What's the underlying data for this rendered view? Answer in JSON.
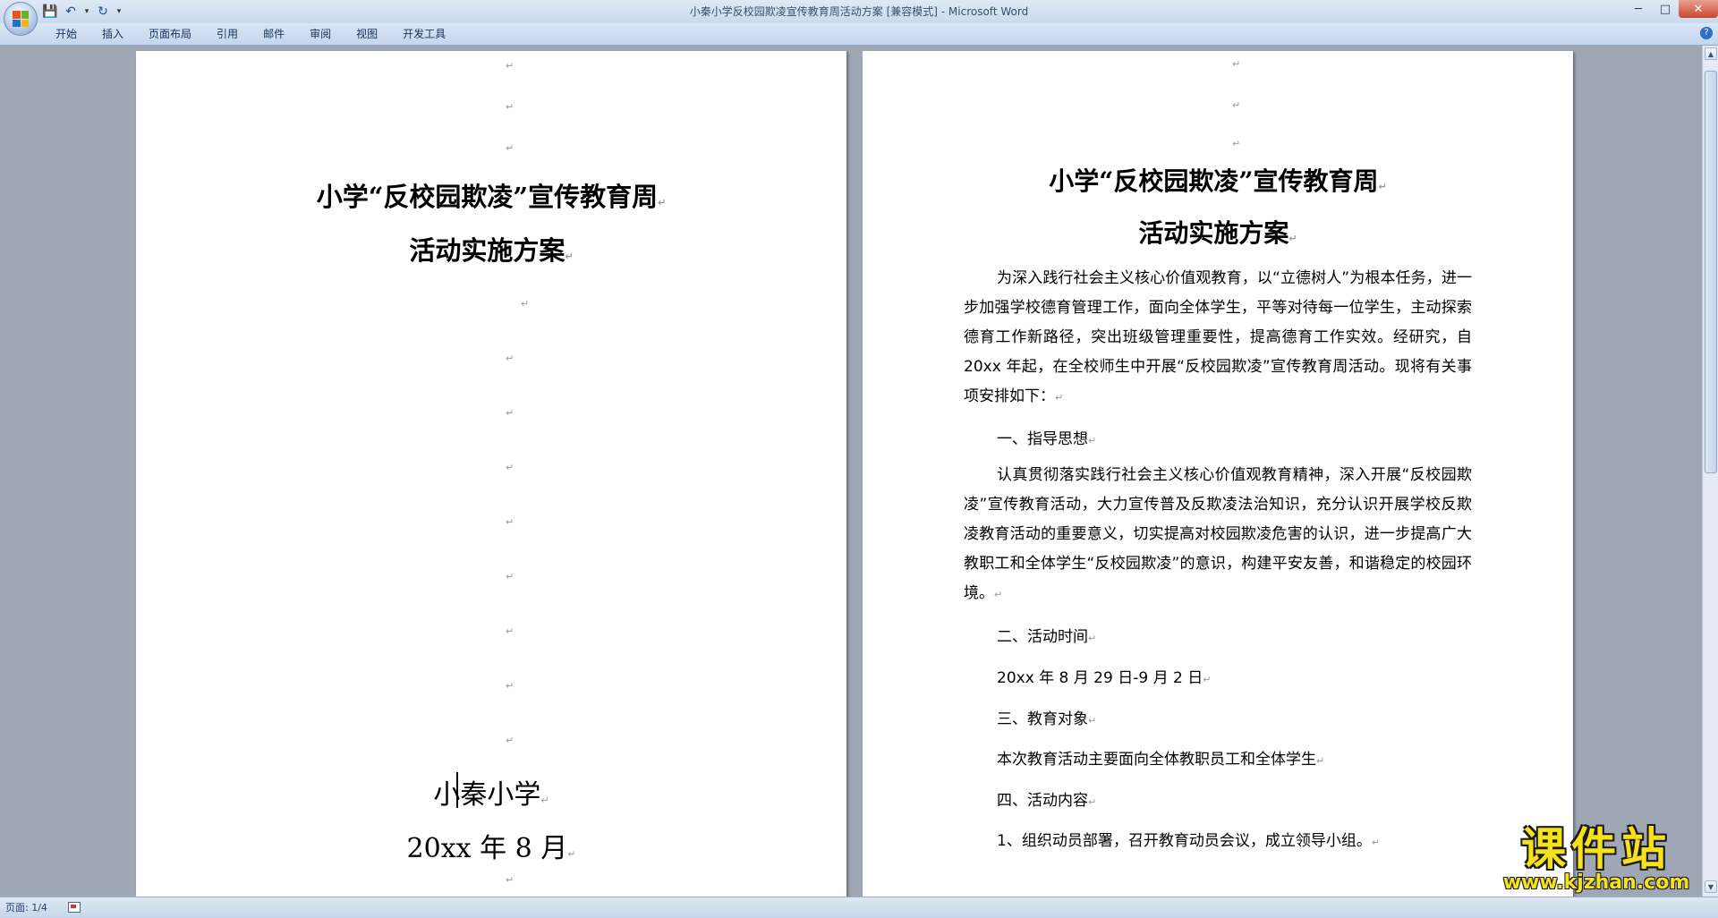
{
  "window": {
    "title": "小秦小学反校园欺凌宣传教育周活动方案 [兼容模式] - Microsoft Word",
    "controls": {
      "minimize": "─",
      "maximize": "□",
      "close": "✕"
    }
  },
  "quick_access": {
    "save_icon": "💾",
    "undo_icon": "↶",
    "dropdown_icon": "▾",
    "redo_icon": "↻",
    "customize_icon": "▾"
  },
  "menu": {
    "items": [
      "开始",
      "插入",
      "页面布局",
      "引用",
      "邮件",
      "审阅",
      "视图",
      "开发工具"
    ],
    "help_icon": "?"
  },
  "para_mark": "↵",
  "page1": {
    "title_line1": "小学“反校园欺凌”宣传教育周",
    "title_line2": "活动实施方案",
    "school": "小秦小学",
    "date": "20xx 年 8 月"
  },
  "page2": {
    "title_line1": "小学“反校园欺凌”宣传教育周",
    "title_line2": "活动实施方案",
    "intro": "为深入践行社会主义核心价值观教育，以“立德树人”为根本任务，进一步加强学校德育管理工作，面向全体学生，平等对待每一位学生，主动探索德育工作新路径，突出班级管理重要性，提高德育工作实效。经研究，自 20xx 年起，在全校师生中开展“反校园欺凌”宣传教育周活动。现将有关事项安排如下：",
    "section1_heading": "一、指导思想",
    "section1_body": "认真贯彻落实践行社会主义核心价值观教育精神，深入开展“反校园欺凌”宣传教育活动，大力宣传普及反欺凌法治知识，充分认识开展学校反欺凌教育活动的重要意义，切实提高对校园欺凌危害的认识，进一步提高广大教职工和全体学生“反校园欺凌”的意识，构建平安友善，和谐稳定的校园环境。",
    "section2_heading": "二、活动时间",
    "section2_body": "20xx 年 8 月 29 日-9 月 2 日",
    "section3_heading": "三、教育对象",
    "section3_body": "本次教育活动主要面向全体教职员工和全体学生",
    "section4_heading": "四、活动内容",
    "section4_item1": "1、组织动员部署，召开教育动员会议，成立领导小组。"
  },
  "status": {
    "page_info": "页面: 1/4"
  },
  "watermark": {
    "main": "课件站",
    "url": "www.kjzhan.com"
  },
  "scrollbar": {
    "up_icon": "▲",
    "down_icon": "▼"
  }
}
